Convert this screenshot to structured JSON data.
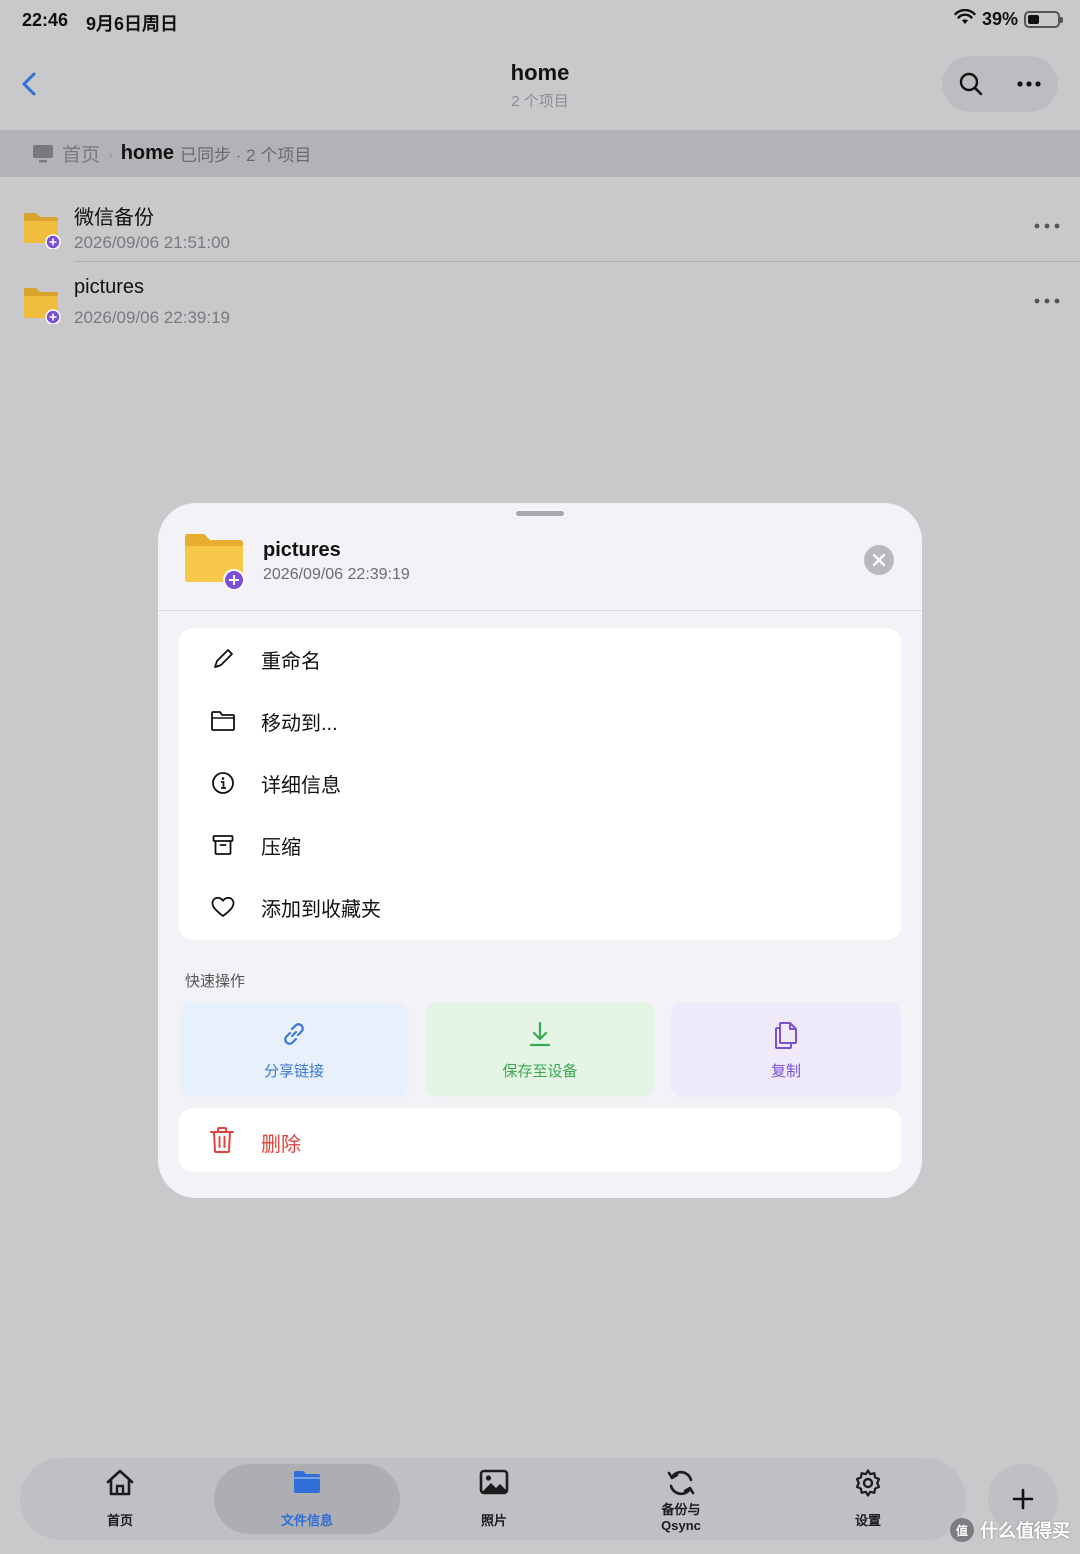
{
  "status_bar": {
    "time": "22:46",
    "date": "9月6日周日",
    "battery_text": "39%",
    "battery_level": 0.39
  },
  "nav": {
    "title": "home",
    "subtitle": "2 个项目",
    "icons": [
      "chevron-left-icon",
      "search-icon",
      "more-icon"
    ]
  },
  "breadcrumb": {
    "root": "首页",
    "current": "home",
    "meta": "已同步 · 2 个项目"
  },
  "files": [
    {
      "name": "微信备份",
      "date": "2026/09/06 21:51:00"
    },
    {
      "name": "pictures",
      "date": "2026/09/06 22:39:19"
    }
  ],
  "sheet": {
    "name": "pictures",
    "date": "2026/09/06 22:39:19",
    "menu": [
      {
        "label": "重命名",
        "icon": "pencil-icon"
      },
      {
        "label": "移动到...",
        "icon": "folder-icon"
      },
      {
        "label": "详细信息",
        "icon": "info-icon"
      },
      {
        "label": "压缩",
        "icon": "archive-icon"
      },
      {
        "label": "添加到收藏夹",
        "icon": "heart-icon"
      }
    ],
    "quick_title": "快速操作",
    "quick": [
      {
        "label": "分享链接",
        "icon": "link-icon",
        "color": "#3a78d6",
        "bg": "#e8f0fb"
      },
      {
        "label": "保存至设备",
        "icon": "download-icon",
        "color": "#39a852",
        "bg": "#e4f5e6"
      },
      {
        "label": "复制",
        "icon": "copy-icon",
        "color": "#7c4fd3",
        "bg": "#efeafa"
      }
    ],
    "delete_label": "删除"
  },
  "tabbar": {
    "tabs": [
      {
        "label": "首页",
        "icon": "home-icon"
      },
      {
        "label": "文件信息",
        "icon": "folder-icon",
        "active": true
      },
      {
        "label": "照片",
        "icon": "photo-icon"
      },
      {
        "label": "备份与\nQsync",
        "icon": "sync-icon"
      },
      {
        "label": "设置",
        "icon": "gear-icon"
      }
    ],
    "active_color": "#2f6fd6"
  },
  "watermark": {
    "badge": "值",
    "text": "什么值得买"
  },
  "colors": {
    "folder": "#f0bd3c",
    "badge": "#7b4fd6",
    "delete": "#e0433b",
    "accent": "#2f6fd6"
  }
}
